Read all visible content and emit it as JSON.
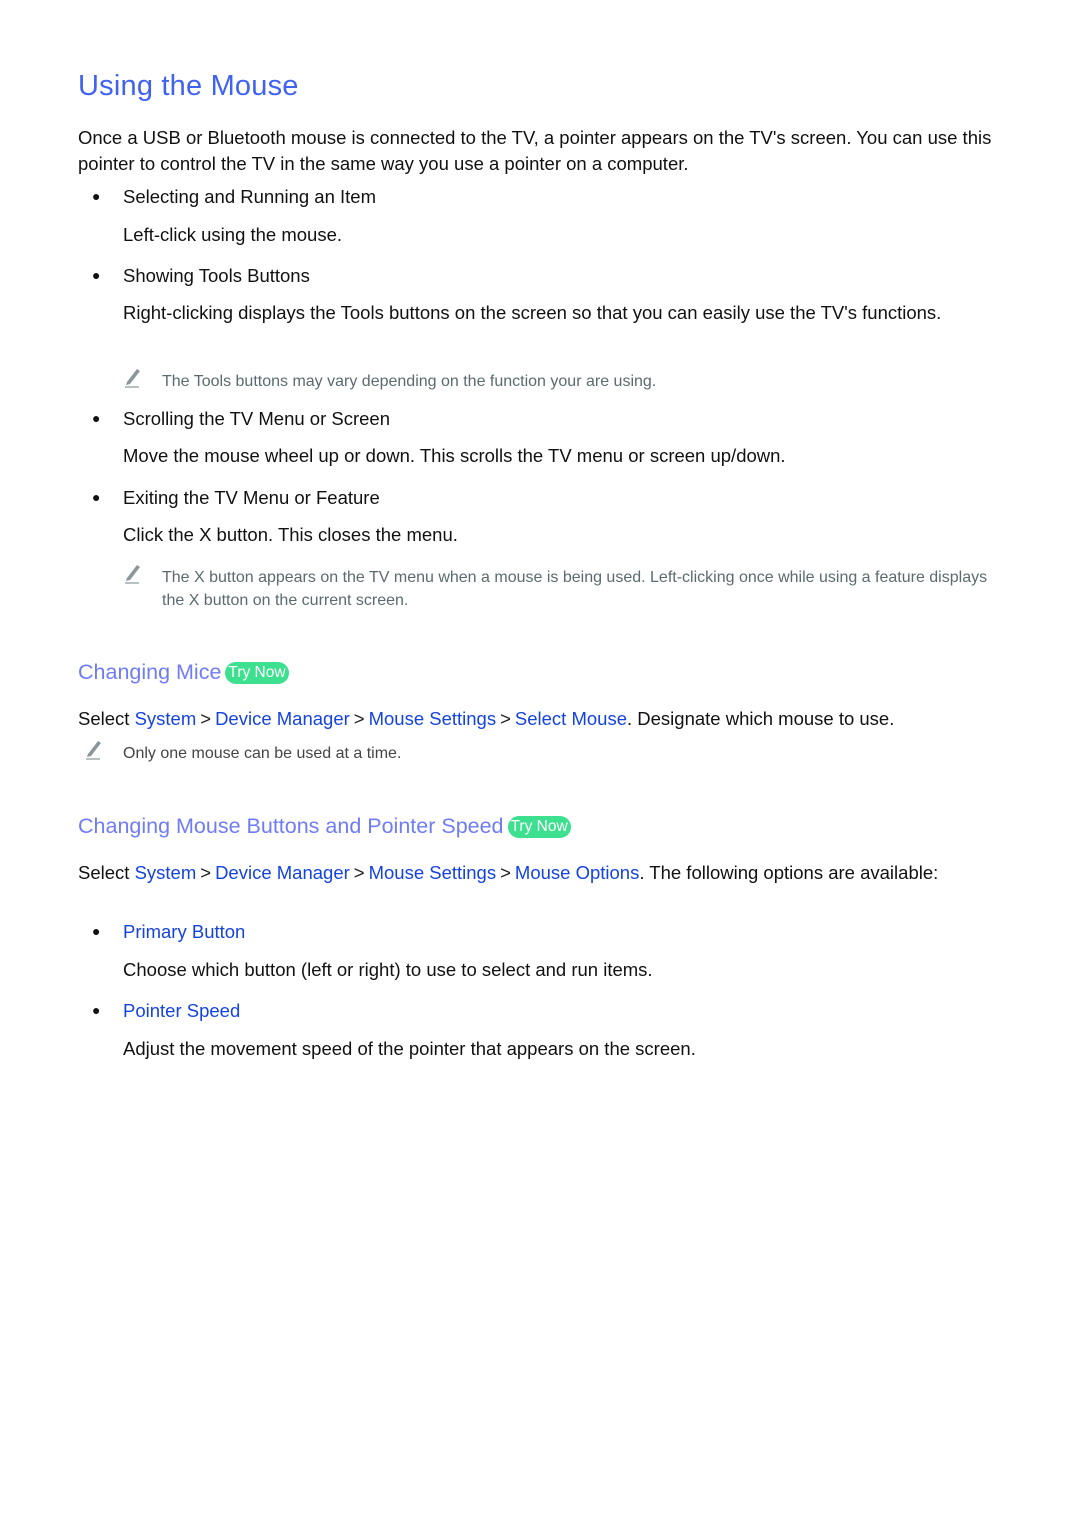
{
  "title": "Using the Mouse",
  "intro": "Once a USB or Bluetooth mouse is connected to the TV, a pointer appears on the TV's screen. You can use this pointer to control the TV in the same way you use a pointer on a computer.",
  "items": [
    {
      "heading": "Selecting and Running an Item",
      "desc": "Left-click using the mouse."
    },
    {
      "heading": "Showing Tools Buttons",
      "desc": "Right-clicking displays the Tools buttons on the screen so that you can easily use the TV's functions.",
      "note": "The Tools buttons may vary depending on the function your are using."
    },
    {
      "heading": "Scrolling the TV Menu or Screen",
      "desc": "Move the mouse wheel up or down. This scrolls the TV menu or screen up/down."
    },
    {
      "heading": "Exiting the TV Menu or Feature",
      "desc": "Click the X button. This closes the menu.",
      "note": "The X button appears on the TV menu when a mouse is being used. Left-clicking once while using a feature displays the X button on the current screen."
    }
  ],
  "section1": {
    "heading": "Changing Mice",
    "try_now": "Try Now",
    "select_word": "Select",
    "path": [
      "System",
      "Device Manager",
      "Mouse Settings",
      "Select Mouse"
    ],
    "separator": ">",
    "after_path": ". Designate which mouse to use.",
    "note": "Only one mouse can be used at a time."
  },
  "section2": {
    "heading": "Changing Mouse Buttons and Pointer Speed",
    "try_now": "Try Now",
    "select_word": "Select",
    "path": [
      "System",
      "Device Manager",
      "Mouse Settings",
      "Mouse Options"
    ],
    "separator": ">",
    "after_path": ". The following options are available:",
    "options": [
      {
        "heading": "Primary Button",
        "desc": "Choose which button (left or right) to use to select and run items."
      },
      {
        "heading": "Pointer Speed",
        "desc": "Adjust the movement speed of the pointer that appears on the screen."
      }
    ]
  },
  "icons": {
    "note": "pencil-icon",
    "bullet": "bullet-dot"
  },
  "colors": {
    "title": "#3f63f0",
    "subheading": "#6f7cf5",
    "link": "#1443e0",
    "try_now_bg": "#3de08f",
    "note_text": "#5b6a6e"
  }
}
